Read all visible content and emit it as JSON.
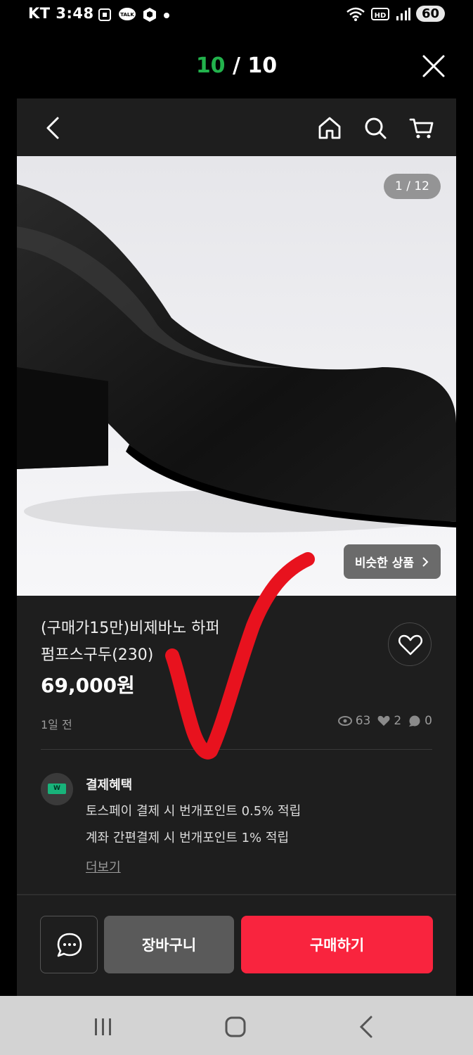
{
  "status_bar": {
    "carrier_time": "KT 3:48",
    "battery": "60",
    "hd": "HD"
  },
  "viewer": {
    "current": "10",
    "separator": " / ",
    "total": "10"
  },
  "product": {
    "image_counter": "1 / 12",
    "similar_label": "비슷한 상품",
    "title_line1": "(구매가15만)비제바노 하퍼",
    "title_line2": "펌프스구두(230)",
    "price": "69,000원",
    "posted": "1일 전",
    "views": "63",
    "likes": "2",
    "comments": "0"
  },
  "benefit": {
    "badge": "W",
    "title": "결제혜택",
    "lines": [
      "토스페이 결제 시 번개포인트 0.5% 적립",
      "계좌 간편결제 시 번개포인트 1% 적립"
    ],
    "more": "더보기"
  },
  "actions": {
    "cart": "장바구니",
    "buy": "구매하기"
  },
  "colors": {
    "accent_green": "#22b24c",
    "buy_red": "#f9243e",
    "annotation_red": "#e8121e"
  }
}
